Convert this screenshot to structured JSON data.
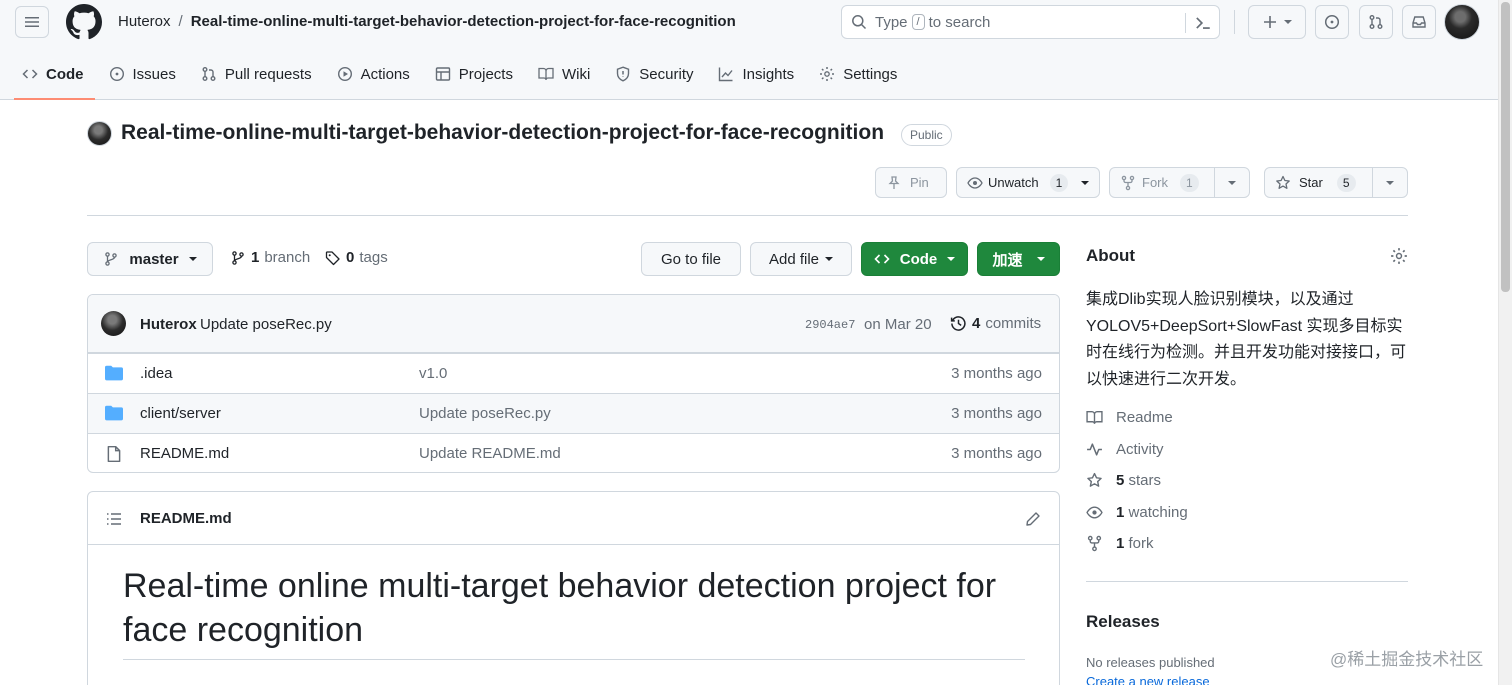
{
  "header": {
    "breadcrumb_owner": "Huterox",
    "breadcrumb_sep": "/",
    "breadcrumb_repo": "Real-time-online-multi-target-behavior-detection-project-for-face-recognition",
    "search_prefix": "Type",
    "search_key": "/",
    "search_suffix": "to search"
  },
  "tabs": [
    {
      "label": "Code",
      "icon": "code-icon"
    },
    {
      "label": "Issues",
      "icon": "issue-icon"
    },
    {
      "label": "Pull requests",
      "icon": "pull-request-icon"
    },
    {
      "label": "Actions",
      "icon": "play-icon"
    },
    {
      "label": "Projects",
      "icon": "table-icon"
    },
    {
      "label": "Wiki",
      "icon": "book-icon"
    },
    {
      "label": "Security",
      "icon": "shield-icon"
    },
    {
      "label": "Insights",
      "icon": "graph-icon"
    },
    {
      "label": "Settings",
      "icon": "gear-icon"
    }
  ],
  "repo": {
    "title": "Real-time-online-multi-target-behavior-detection-project-for-face-recognition",
    "visibility": "Public",
    "pin_label": "Pin",
    "unwatch_label": "Unwatch",
    "watch_count": "1",
    "fork_label": "Fork",
    "fork_count": "1",
    "star_label": "Star",
    "star_count": "5"
  },
  "controls": {
    "branch": "master",
    "branch_count": "1",
    "branch_label": "branch",
    "tag_count": "0",
    "tag_label": "tags",
    "go_to_file": "Go to file",
    "add_file": "Add file",
    "code": "Code",
    "accelerate": "加速"
  },
  "commit": {
    "author": "Huterox",
    "message": "Update poseRec.py",
    "sha": "2904ae7",
    "date": "on Mar 20",
    "count": "4",
    "count_label": "commits"
  },
  "files": [
    {
      "name": ".idea",
      "message": "v1.0",
      "age": "3 months ago",
      "type": "folder"
    },
    {
      "name": "client/server",
      "message": "Update poseRec.py",
      "age": "3 months ago",
      "type": "folder"
    },
    {
      "name": "README.md",
      "message": "Update README.md",
      "age": "3 months ago",
      "type": "file"
    }
  ],
  "readme": {
    "filename": "README.md",
    "heading": "Real-time online multi-target behavior detection project for face recognition"
  },
  "about": {
    "title": "About",
    "description": "集成Dlib实现人脸识别模块，以及通过YOLOV5+DeepSort+SlowFast 实现多目标实时在线行为检测。并且开发功能对接接口，可以快速进行二次开发。",
    "readme": "Readme",
    "activity": "Activity",
    "stars_count": "5",
    "stars_label": "stars",
    "watching_count": "1",
    "watching_label": "watching",
    "fork_count": "1",
    "fork_label": "fork"
  },
  "releases": {
    "title": "Releases",
    "none": "No releases published",
    "create_link": "Create a new release"
  },
  "watermark": "@稀土掘金技术社区",
  "colors": {
    "accent_green": "#1f883d",
    "link_blue": "#0969da",
    "tab_underline": "#fd8c73",
    "folder_blue": "#54aeff"
  }
}
